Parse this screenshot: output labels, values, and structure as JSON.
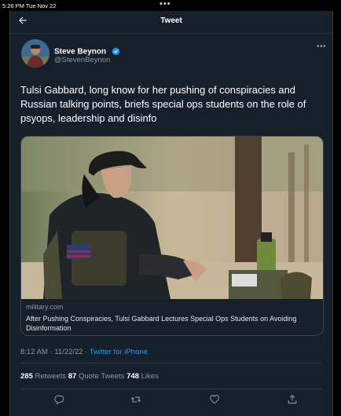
{
  "status_bar": {
    "time": "5:26 PM  Tue Nov 22",
    "dots": "•••"
  },
  "header": {
    "title": "Tweet",
    "back_icon": "arrow-left-icon"
  },
  "author": {
    "name": "Steve Beynon",
    "handle": "@StevenBeynon",
    "verified": true
  },
  "tweet": {
    "text": "Tulsi Gabbard, long know for her pushing of conspiracies and Russian talking points, briefs special ops students on the role of psyops, leadership and disinfo"
  },
  "link_card": {
    "domain": "military.com",
    "title": "After Pushing Conspiracies, Tulsi Gabbard Lectures Special Ops Students on Avoiding Disinformation"
  },
  "meta": {
    "time": "8:12 AM",
    "date": "11/22/22",
    "separator": "·",
    "source": "Twitter for iPhone"
  },
  "stats": {
    "retweets_count": "285",
    "retweets_label": "Retweets",
    "quotes_count": "87",
    "quotes_label": "Quote Tweets",
    "likes_count": "748",
    "likes_label": "Likes"
  },
  "actions": [
    "reply-icon",
    "retweet-icon",
    "like-icon",
    "share-icon"
  ],
  "colors": {
    "background": "#15202b",
    "accent": "#1d9bf0",
    "secondary_text": "#8b98a5",
    "border": "#38444d"
  }
}
